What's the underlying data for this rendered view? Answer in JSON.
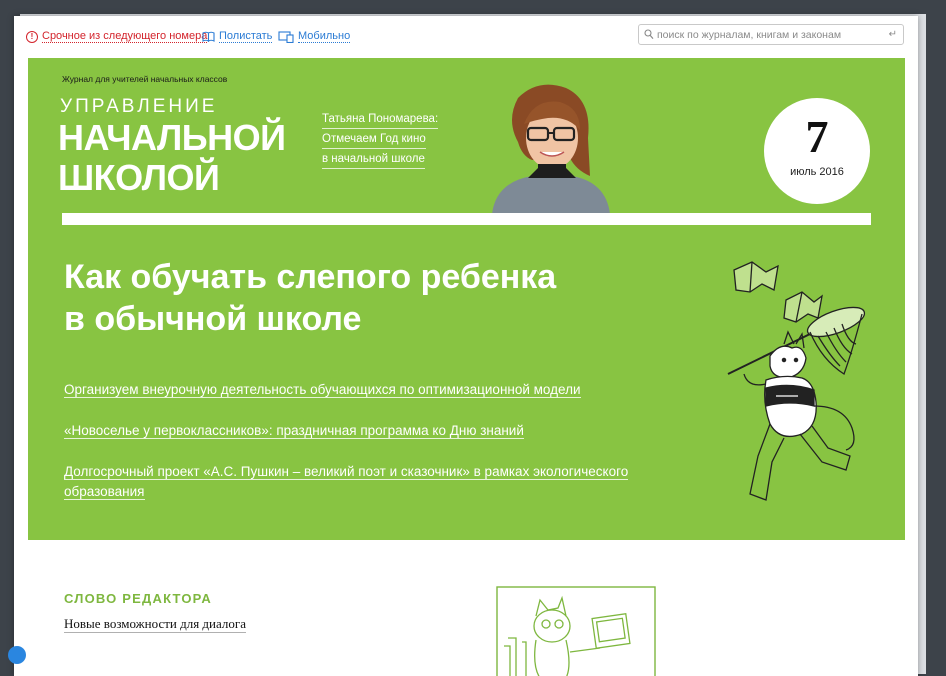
{
  "topbar": {
    "urgent_label": "Срочное из следующего номера",
    "flip_label": "Полистать",
    "mobile_label": "Мобильно",
    "search_placeholder": "поиск по журналам, книгам и законам",
    "enter_glyph": "↵"
  },
  "magazine": {
    "subtitle": "Журнал для учителей начальных классов",
    "logo_line1": "УПРАВЛЕНИЕ",
    "logo_line2": "НАЧАЛЬНОЙ",
    "logo_line3": "ШКОЛОЙ"
  },
  "author": {
    "name": "Татьяна Пономарева:",
    "line2": "Отмечаем Год кино",
    "line3": "в начальной школе"
  },
  "issue": {
    "number": "7",
    "date": "июль 2016"
  },
  "headline": {
    "line1": "Как обучать слепого ребенка",
    "line2": "в обычной школе"
  },
  "articles": [
    "Организуем внеурочную деятельность обучающихся по оптимизационной модели",
    "«Новоселье у первоклассников»: праздничная программа ко Дню знаний",
    "Долгосрочный проект «А.С. Пушкин – великий поэт и сказочник» в рамках экологического образования"
  ],
  "editor": {
    "section_title": "СЛОВО РЕДАКТОРА",
    "article_title": "Новые возможности для диалога"
  },
  "colors": {
    "hero_green": "#88c442",
    "accent_green": "#7eb73f",
    "link_blue": "#2a7bd4",
    "alert_red": "#d3242c",
    "frame_dark": "#3d434a"
  },
  "icons": {
    "urgent": "alert-circle-icon",
    "flip": "open-book-icon",
    "mobile": "devices-icon",
    "search": "search-icon"
  }
}
